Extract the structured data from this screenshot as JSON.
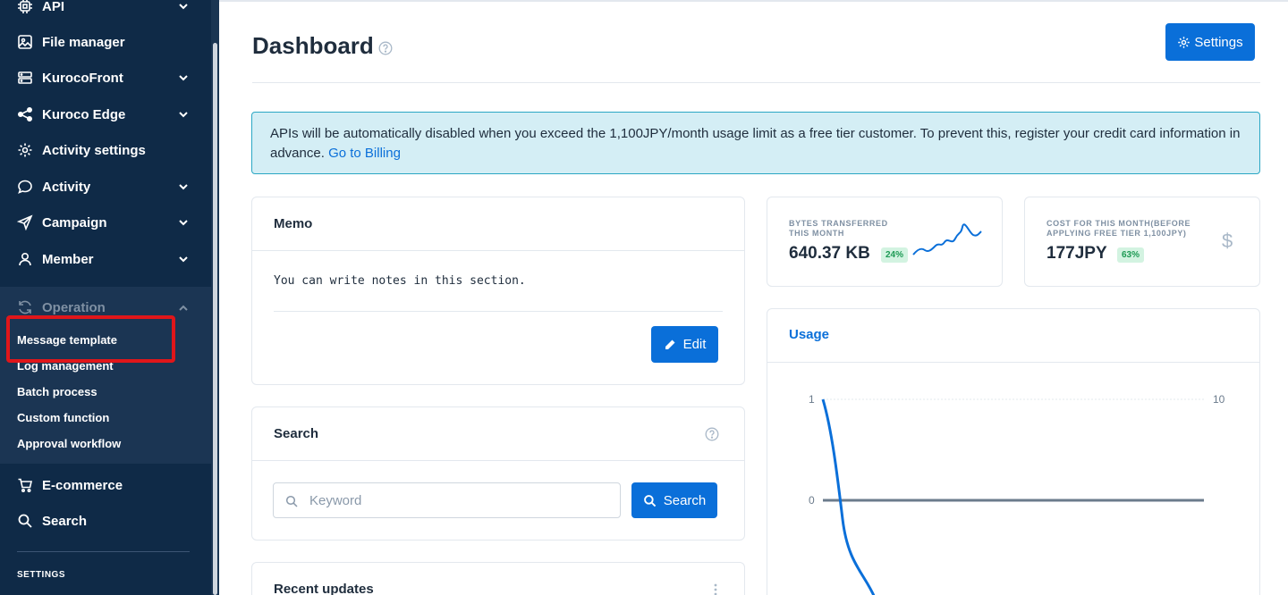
{
  "sidebar": {
    "items": [
      {
        "label": "API",
        "icon": "chip-icon",
        "has_chevron": true
      },
      {
        "label": "File manager",
        "icon": "image-icon",
        "has_chevron": false
      },
      {
        "label": "KurocoFront",
        "icon": "server-icon",
        "has_chevron": true
      },
      {
        "label": "Kuroco Edge",
        "icon": "share-icon",
        "has_chevron": true
      },
      {
        "label": "Activity settings",
        "icon": "gear-icon",
        "has_chevron": false
      },
      {
        "label": "Activity",
        "icon": "chat-icon",
        "has_chevron": true
      },
      {
        "label": "Campaign",
        "icon": "send-icon",
        "has_chevron": true
      },
      {
        "label": "Member",
        "icon": "user-icon",
        "has_chevron": true
      }
    ],
    "operation": {
      "label": "Operation",
      "icon": "refresh-icon",
      "sub_items": [
        "Message template",
        "Log management",
        "Batch process",
        "Custom function",
        "Approval workflow"
      ]
    },
    "bottom_items": [
      {
        "label": "E-commerce",
        "icon": "cart-icon"
      },
      {
        "label": "Search",
        "icon": "search-icon"
      }
    ],
    "settings_label": "SETTINGS"
  },
  "header": {
    "title": "Dashboard",
    "settings_button": "Settings"
  },
  "alert": {
    "text": "APIs will be automatically disabled when you exceed the 1,100JPY/month usage limit as a free tier customer. To prevent this, register your credit card information in advance.",
    "link": "Go to Billing"
  },
  "memo": {
    "title": "Memo",
    "text": "You can write notes in this section.",
    "edit_button": "Edit"
  },
  "search": {
    "title": "Search",
    "placeholder": "Keyword",
    "button": "Search"
  },
  "recent": {
    "title": "Recent updates"
  },
  "stats": {
    "bytes": {
      "label": "BYTES TRANSFERRED THIS MONTH",
      "value": "640.37 KB",
      "badge": "24%"
    },
    "cost": {
      "label": "COST FOR THIS MONTH(BEFORE APPLYING FREE TIER 1,100JPY)",
      "value": "177JPY",
      "badge": "63%"
    }
  },
  "usage": {
    "title": "Usage",
    "y_left_top": "1",
    "y_left_mid": "0",
    "y_right_top": "10"
  },
  "colors": {
    "sidebar_bg": "#0f2a47",
    "primary": "#0a6fd9",
    "alert_bg": "#d4eef5",
    "highlight": "#e0161a",
    "badge_bg": "#d3f3e1"
  }
}
